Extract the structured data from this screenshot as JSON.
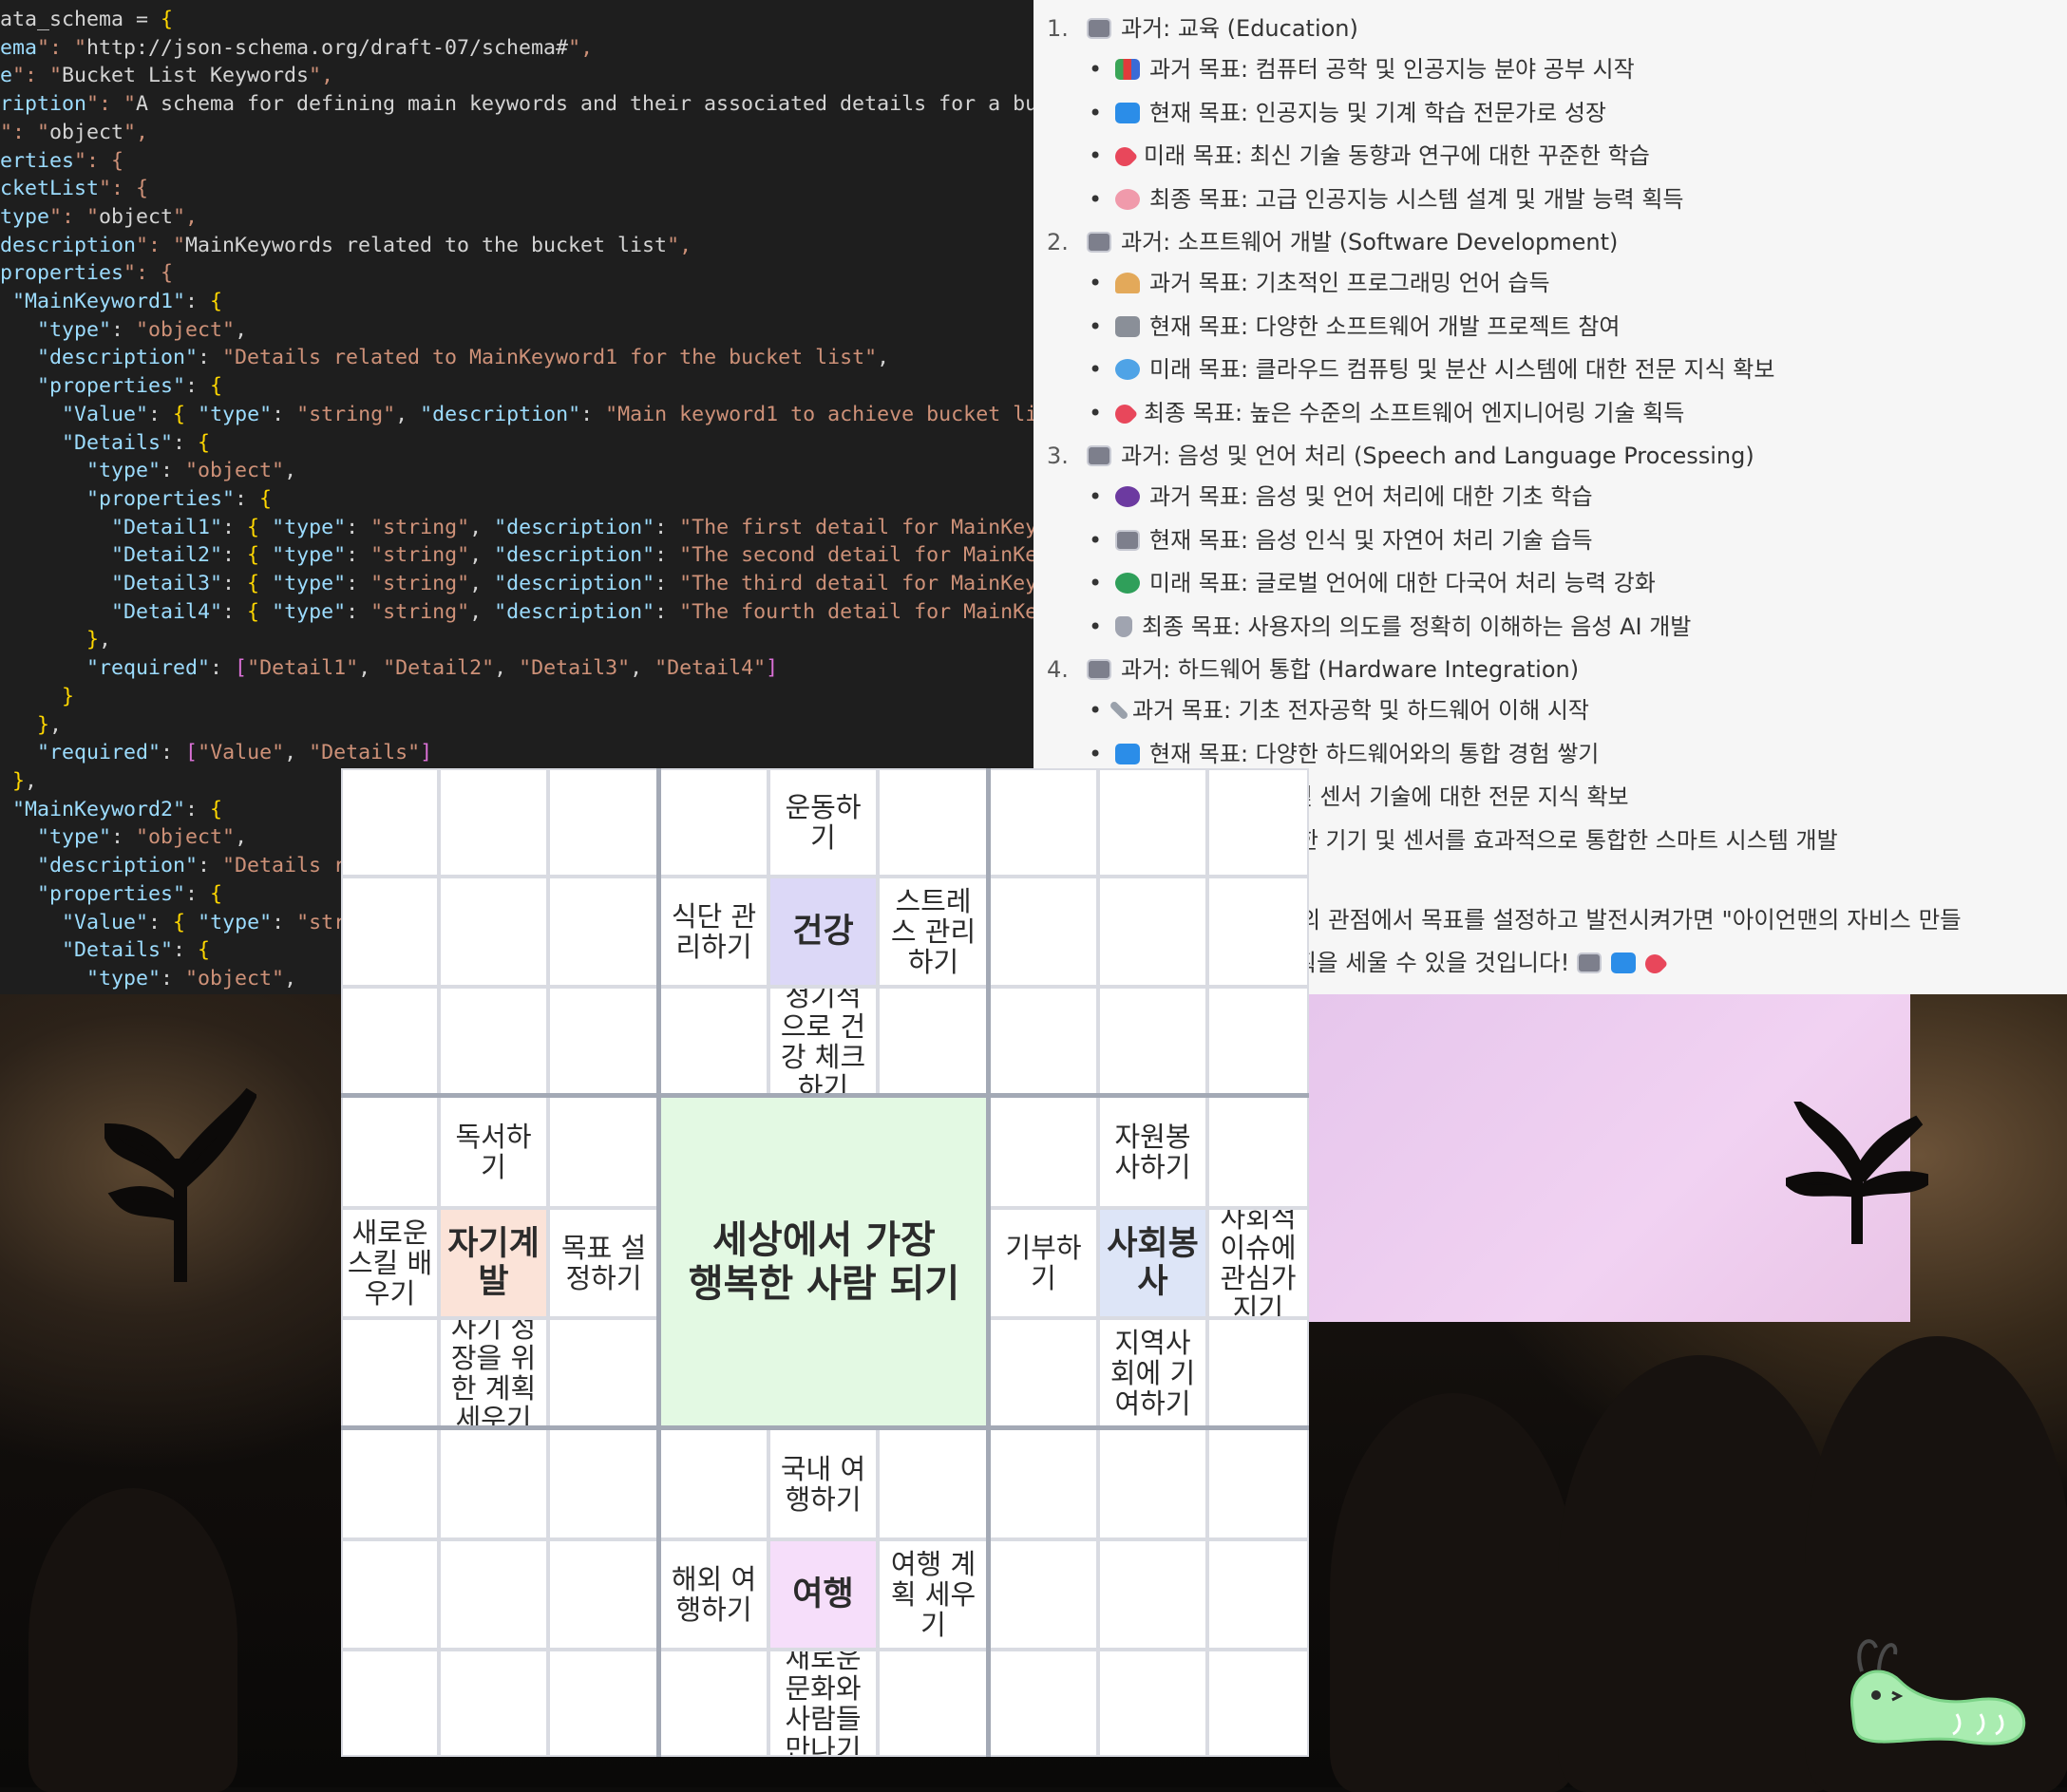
{
  "code_editor": {
    "lines": [
      "ata_schema = {",
      "ema\": \"http://json-schema.org/draft-07/schema#\",",
      "e\": \"Bucket List Keywords\",",
      "ription\": \"A schema for defining main keywords and their associated details for a bucket l",
      "\": \"object\",",
      "erties\": {",
      "cketList\": {",
      "type\": \"object\",",
      "description\": \"MainKeywords related to the bucket list\",",
      "properties\": {",
      " \"MainKeyword1\": {",
      "   \"type\": \"object\",",
      "   \"description\": \"Details related to MainKeyword1 for the bucket list\",",
      "   \"properties\": {",
      "     \"Value\": { \"type\": \"string\", \"description\": \"Main keyword1 to achieve bucket list\" },",
      "     \"Details\": {",
      "       \"type\": \"object\",",
      "       \"properties\": {",
      "         \"Detail1\": { \"type\": \"string\", \"description\": \"The first detail for MainKeyword1.",
      "         \"Detail2\": { \"type\": \"string\", \"description\": \"The second detail for MainKeyword1",
      "         \"Detail3\": { \"type\": \"string\", \"description\": \"The third detail for MainKeyword1.",
      "         \"Detail4\": { \"type\": \"string\", \"description\": \"The fourth detail for MainKeyword1",
      "       },",
      "       \"required\": [\"Detail1\", \"Detail2\", \"Detail3\", \"Detail4\"]",
      "     }",
      "   },",
      "   \"required\": [\"Value\", \"Details\"]",
      " },",
      " \"MainKeyword2\": {",
      "   \"type\": \"object\",",
      "   \"description\": \"Details rel",
      "   \"properties\": {",
      "     \"Value\": { \"type\": \"strin",
      "     \"Details\": {",
      "       \"type\": \"object\","
    ]
  },
  "chat": {
    "sections": [
      {
        "number": "1.",
        "emoji": "robot",
        "title": "과거: 교육 (Education)",
        "items": [
          {
            "emoji": "books",
            "text": "과거 목표: 컴퓨터 공학 및 인공지능 분야 공부 시작"
          },
          {
            "emoji": "laptop",
            "text": "현재 목표: 인공지능 및 기계 학습 전문가로 성장"
          },
          {
            "emoji": "rocket",
            "text": "미래 목표: 최신 기술 동향과 연구에 대한 꾸준한 학습"
          },
          {
            "emoji": "brain",
            "text": "최종 목표: 고급 인공지능 시스템 설계 및 개발 능력 획득"
          }
        ]
      },
      {
        "number": "2.",
        "emoji": "robot",
        "title": "과거: 소프트웨어 개발 (Software Development)",
        "items": [
          {
            "emoji": "person",
            "text": "과거 목표: 기초적인 프로그래밍 언어 습득"
          },
          {
            "emoji": "tools",
            "text": "현재 목표: 다양한 소프트웨어 개발 프로젝트 참여"
          },
          {
            "emoji": "globe",
            "text": "미래 목표: 클라우드 컴퓨팅 및 분산 시스템에 대한 전문 지식 확보"
          },
          {
            "emoji": "rocket",
            "text": "최종 목표: 높은 수준의 소프트웨어 엔지니어링 기술 획득"
          }
        ]
      },
      {
        "number": "3.",
        "emoji": "robot",
        "title": "과거: 음성 및 언어 처리 (Speech and Language Processing)",
        "items": [
          {
            "emoji": "speech",
            "text": "과거 목표: 음성 및 언어 처리에 대한 기초 학습"
          },
          {
            "emoji": "robot",
            "text": "현재 목표: 음성 인식 및 자연어 처리 기술 습득"
          },
          {
            "emoji": "earth",
            "text": "미래 목표: 글로벌 언어에 대한 다국어 처리 능력 강화"
          },
          {
            "emoji": "mic",
            "text": "최종 목표: 사용자의 의도를 정확히 이해하는 음성 AI 개발"
          }
        ]
      },
      {
        "number": "4.",
        "emoji": "robot",
        "title": "과거: 하드웨어 통합 (Hardware Integration)",
        "items": [
          {
            "emoji": "wrench",
            "text": "과거 목표: 기초 전자공학 및 하드웨어 이해 시작"
          },
          {
            "emoji": "laptop",
            "text": "현재 목표: 다양한 하드웨어와의 통합 경험 쌓기"
          },
          {
            "emoji": "rocket",
            "text": "미래 목표: IoT 및 센서 기술에 대한 전문 지식 확보"
          },
          {
            "emoji": "globe",
            "text": "최종 목표: 다양한 기기 및 센서를 효과적으로 통합한 스마트 시스템 개발"
          }
        ]
      }
    ],
    "outro_line1": "이렇게 과거, 현재, 미래의 관점에서 목표를 설정하고 발전시켜가면 \"아이언맨의 자비스 만들",
    "outro_line2": "기\"를 위한 체계적인 계획을 세울 수 있을 것입니다!",
    "outro_emojis": [
      "robot",
      "laptop",
      "rocket"
    ]
  },
  "mandala": {
    "center": "세상에서 가장\n행복한 사람 되기",
    "blocks": {
      "top": {
        "hub": "건강",
        "color": "#dcd8f7",
        "north": "운동하\n기",
        "west": "식단 관\n리하기",
        "east": "스트레\n스 관리\n하기",
        "south": "정기적\n으로 건\n강 체크\n하기"
      },
      "left": {
        "hub": "자기계\n발",
        "color": "#fbe3d8",
        "north": "독서하\n기",
        "west": "새로운\n스킬 배\n우기",
        "east": "목표 설\n정하기",
        "south": "자기 성\n장을 위\n한 계획\n세우기"
      },
      "right": {
        "hub": "사회봉\n사",
        "color": "#dde5f7",
        "north": "자원봉\n사하기",
        "west": "기부하\n기",
        "east": "사회적\n이슈에\n관심가\n지기",
        "south": "지역사\n회에 기\n여하기"
      },
      "bottom": {
        "hub": "여행",
        "color": "#f6defa",
        "north": "국내 여\n행하기",
        "west": "해외 여\n행하기",
        "east": "여행 계\n획 세우\n기",
        "south": "새로운\n문화와\n사람들\n만나기"
      }
    },
    "center_color": "#e3f9e3"
  },
  "icons": {
    "caterpillar": "caterpillar-sticker-icon",
    "plant_left": "plant-silhouette-icon",
    "plant_right": "plant-silhouette-icon"
  }
}
